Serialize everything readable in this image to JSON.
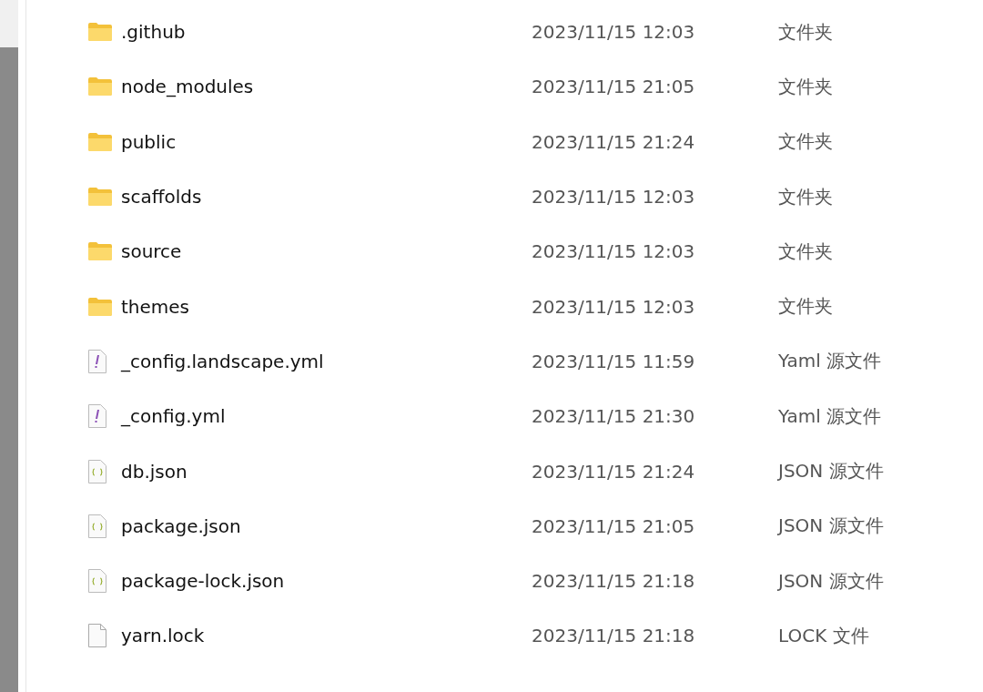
{
  "files": [
    {
      "kind": "folder",
      "name": ".github",
      "modified": "2023/11/15 12:03",
      "type": "文件夹"
    },
    {
      "kind": "folder",
      "name": "node_modules",
      "modified": "2023/11/15 21:05",
      "type": "文件夹"
    },
    {
      "kind": "folder",
      "name": "public",
      "modified": "2023/11/15 21:24",
      "type": "文件夹"
    },
    {
      "kind": "folder",
      "name": "scaffolds",
      "modified": "2023/11/15 12:03",
      "type": "文件夹"
    },
    {
      "kind": "folder",
      "name": "source",
      "modified": "2023/11/15 12:03",
      "type": "文件夹"
    },
    {
      "kind": "folder",
      "name": "themes",
      "modified": "2023/11/15 12:03",
      "type": "文件夹"
    },
    {
      "kind": "yaml",
      "name": "_config.landscape.yml",
      "modified": "2023/11/15 11:59",
      "type": "Yaml 源文件"
    },
    {
      "kind": "yaml",
      "name": "_config.yml",
      "modified": "2023/11/15 21:30",
      "type": "Yaml 源文件"
    },
    {
      "kind": "json",
      "name": "db.json",
      "modified": "2023/11/15 21:24",
      "type": "JSON 源文件"
    },
    {
      "kind": "json",
      "name": "package.json",
      "modified": "2023/11/15 21:05",
      "type": "JSON 源文件"
    },
    {
      "kind": "json",
      "name": "package-lock.json",
      "modified": "2023/11/15 21:18",
      "type": "JSON 源文件"
    },
    {
      "kind": "file",
      "name": "yarn.lock",
      "modified": "2023/11/15 21:18",
      "type": "LOCK 文件"
    }
  ]
}
